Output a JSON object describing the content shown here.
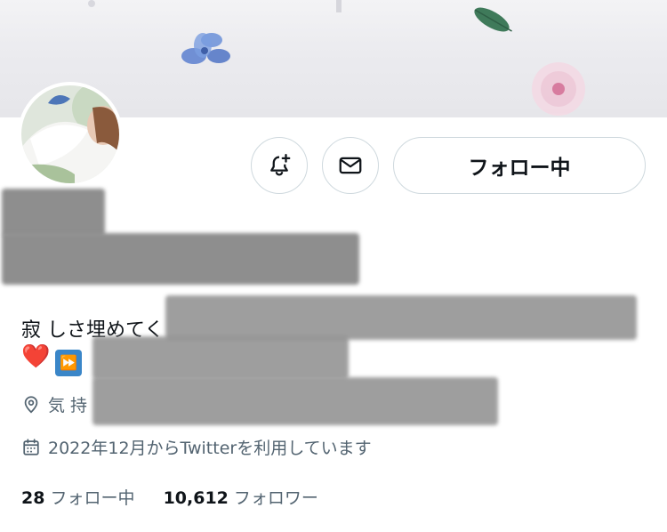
{
  "header": {
    "follow_button_label": "フォロー中"
  },
  "icons": {
    "notify": "bell-plus-icon",
    "message": "envelope-icon",
    "location": "location-pin-icon",
    "calendar": "calendar-icon"
  },
  "profile": {
    "bio_line1_visible": "寂 しさ埋めてく",
    "bio_emoji_heart": "❤️",
    "bio_emoji_forward": "⏩",
    "location_visible": "気 持",
    "joined": "2022年12月からTwitterを利用しています"
  },
  "stats": {
    "following_count": "28",
    "following_label": "フォロー中",
    "followers_count": "10,612",
    "followers_label": "フォロワー"
  },
  "colors": {
    "text_primary": "#0f1419",
    "text_secondary": "#536471",
    "border": "#cfd9de"
  }
}
